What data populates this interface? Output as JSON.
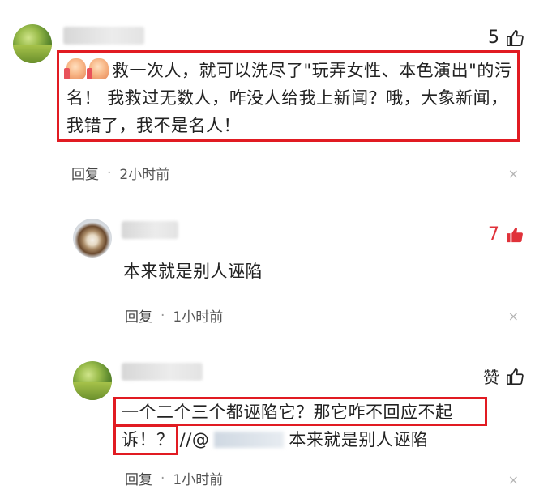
{
  "comments": [
    {
      "likes": "5",
      "text": "救一次人，就可以洗尽了\"玩弄女性、本色演出\"的污名！ 我救过无数人，咋没人给我上新闻？哦，大象新闻，我错了，我不是名人！",
      "reply_label": "回复",
      "separator": "·",
      "time": "2小时前",
      "close": "×"
    },
    {
      "likes": "7",
      "text": "本来就是别人诬陷",
      "reply_label": "回复",
      "separator": "·",
      "time": "1小时前",
      "close": "×"
    },
    {
      "likes": "赞",
      "text_part1": "一个二个三个都诬陷它？那它咋不回应不起诉！？ //@",
      "text_part2": "本来就是别人诬陷",
      "reply_label": "回复",
      "separator": "·",
      "time": "1小时前",
      "close": "×"
    }
  ],
  "colors": {
    "highlight": "#e11b22",
    "hot_like": "#e0323a"
  }
}
